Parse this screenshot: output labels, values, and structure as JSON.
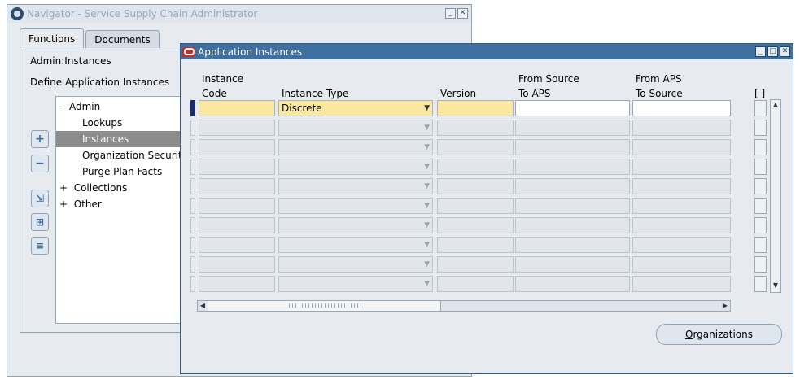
{
  "navigator": {
    "title": "Navigator - Service Supply Chain Administrator",
    "tabs": [
      "Functions",
      "Documents"
    ],
    "path_label": "Admin:Instances",
    "description": "Define Application Instances",
    "tree": [
      {
        "prefix": "-",
        "label": "Admin",
        "indent": 0,
        "selected": false
      },
      {
        "prefix": "",
        "label": "Lookups",
        "indent": 1,
        "selected": false
      },
      {
        "prefix": "",
        "label": "Instances",
        "indent": 1,
        "selected": true
      },
      {
        "prefix": "",
        "label": "Organization Security",
        "indent": 1,
        "selected": false
      },
      {
        "prefix": "",
        "label": "Purge Plan Facts",
        "indent": 1,
        "selected": false
      },
      {
        "prefix": "+",
        "label": "Collections",
        "indent": 0,
        "selected": false
      },
      {
        "prefix": "+",
        "label": "Other",
        "indent": 0,
        "selected": false
      }
    ],
    "side_buttons": [
      "+",
      "−",
      "⇲",
      "⊞",
      "≡"
    ]
  },
  "app": {
    "title": "Application Instances",
    "columns": {
      "instance_code_l1": "Instance",
      "instance_code_l2": "Code",
      "instance_type": "Instance Type",
      "version": "Version",
      "from_source_l1": "From Source",
      "from_source_l2": "To APS",
      "from_aps_l1": "From APS",
      "from_aps_l2": "To Source",
      "flag": "[ ]"
    },
    "first_row": {
      "instance_code": "",
      "instance_type": "Discrete",
      "version": "",
      "from_source": "",
      "from_aps": ""
    },
    "row_count": 10,
    "organizations_button": "Organizations",
    "organizations_mnemonic": "O"
  }
}
